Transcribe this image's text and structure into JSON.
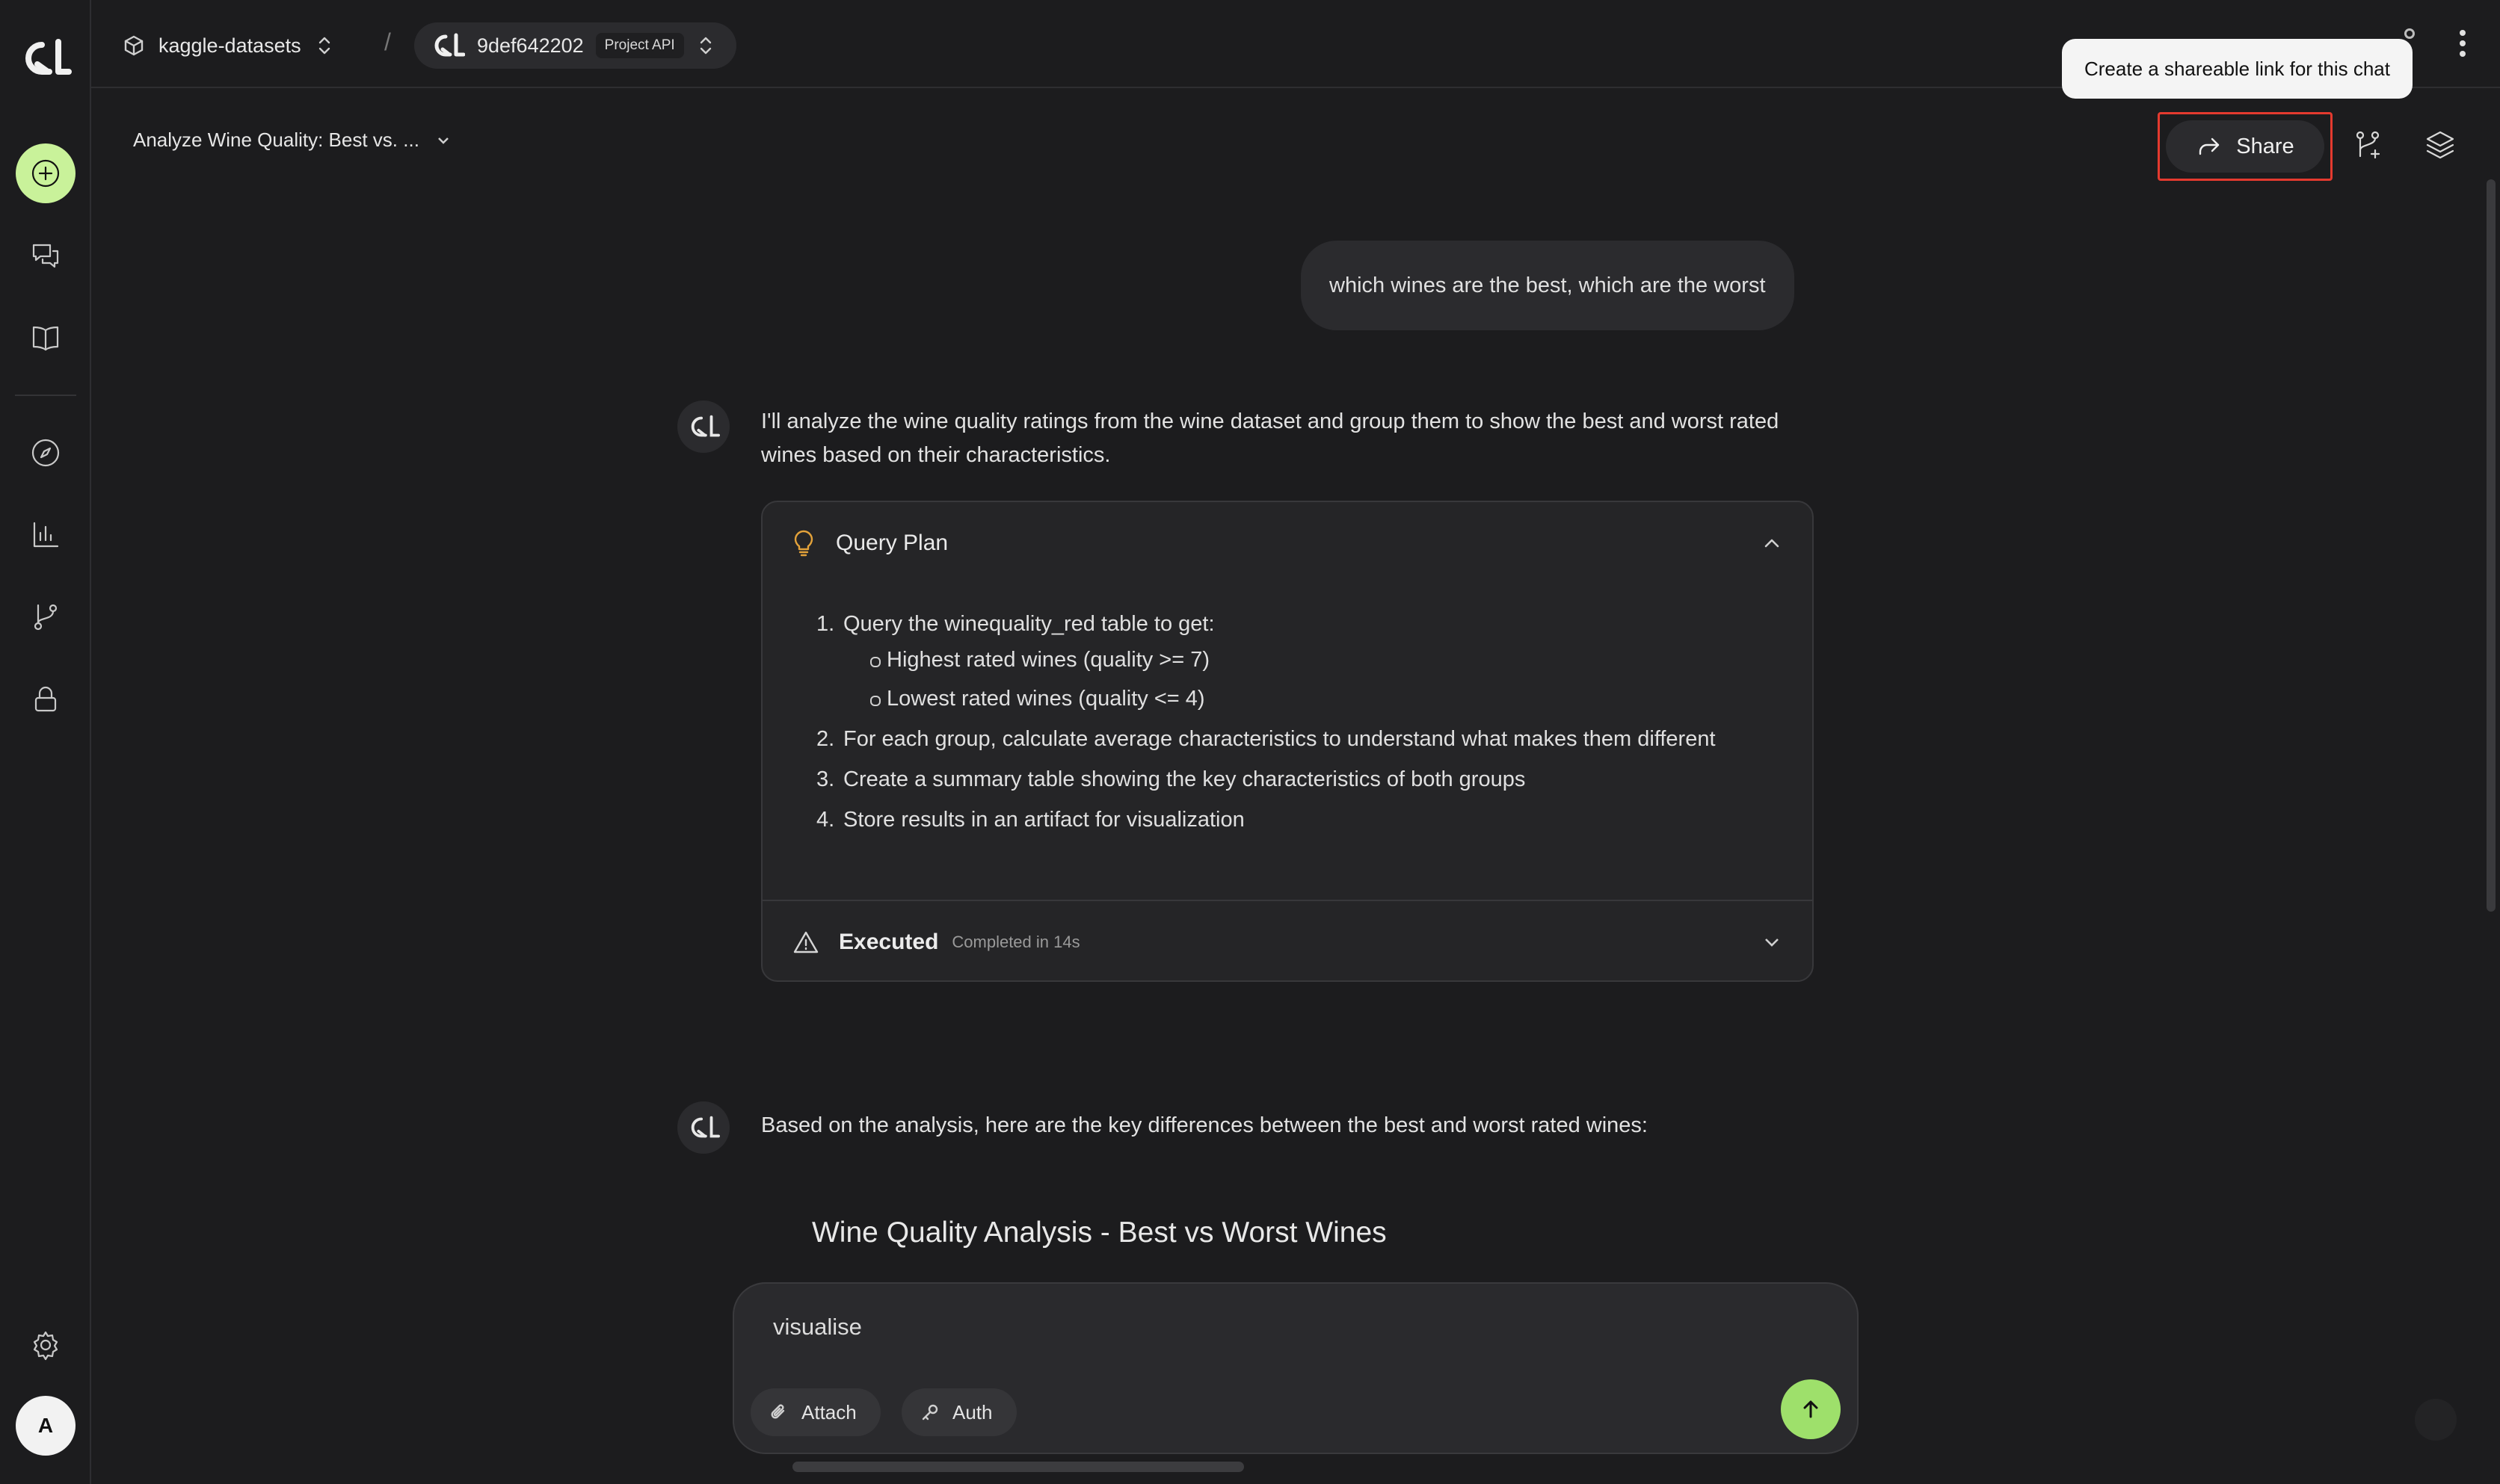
{
  "sidebar": {
    "icons": [
      "new-chat-icon",
      "chats-icon",
      "library-icon",
      "explore-icon",
      "analytics-icon",
      "branch-icon",
      "lock-icon",
      "settings-icon"
    ],
    "avatar_initial": "A",
    "accent_color": "#c9f29a"
  },
  "topbar": {
    "workspace": "kaggle-datasets",
    "separator": "/",
    "project_id": "9def642202",
    "project_tag": "Project API"
  },
  "tooltip": {
    "text": "Create a shareable link for this chat"
  },
  "header": {
    "chat_title": "Analyze Wine Quality: Best vs. ...",
    "share_label": "Share"
  },
  "messages": {
    "user_1": "which wines are the best, which are the worst",
    "bot_1": "I'll analyze the wine quality ratings from the wine dataset and group them to show the best and worst rated wines based on their characteristics.",
    "plan": {
      "title": "Query Plan",
      "steps": [
        {
          "num": "1.",
          "text": "Query the winequality_red table to get:"
        },
        {
          "num": "2.",
          "text": "For each group, calculate average characteristics to understand what makes them different"
        },
        {
          "num": "3.",
          "text": "Create a summary table showing the key characteristics of both groups"
        },
        {
          "num": "4.",
          "text": "Store results in an artifact for visualization"
        }
      ],
      "substeps": [
        "Highest rated wines (quality >= 7)",
        "Lowest rated wines (quality <= 4)"
      ],
      "executed_label": "Executed",
      "executed_meta": "Completed in 14s"
    },
    "bot_2": "Based on the analysis, here are the key differences between the best and worst rated wines:",
    "viz_title": "Wine Quality Analysis - Best vs Worst Wines"
  },
  "composer": {
    "value": "visualise",
    "attach_label": "Attach",
    "auth_label": "Auth",
    "send_color": "#9ee06b"
  }
}
